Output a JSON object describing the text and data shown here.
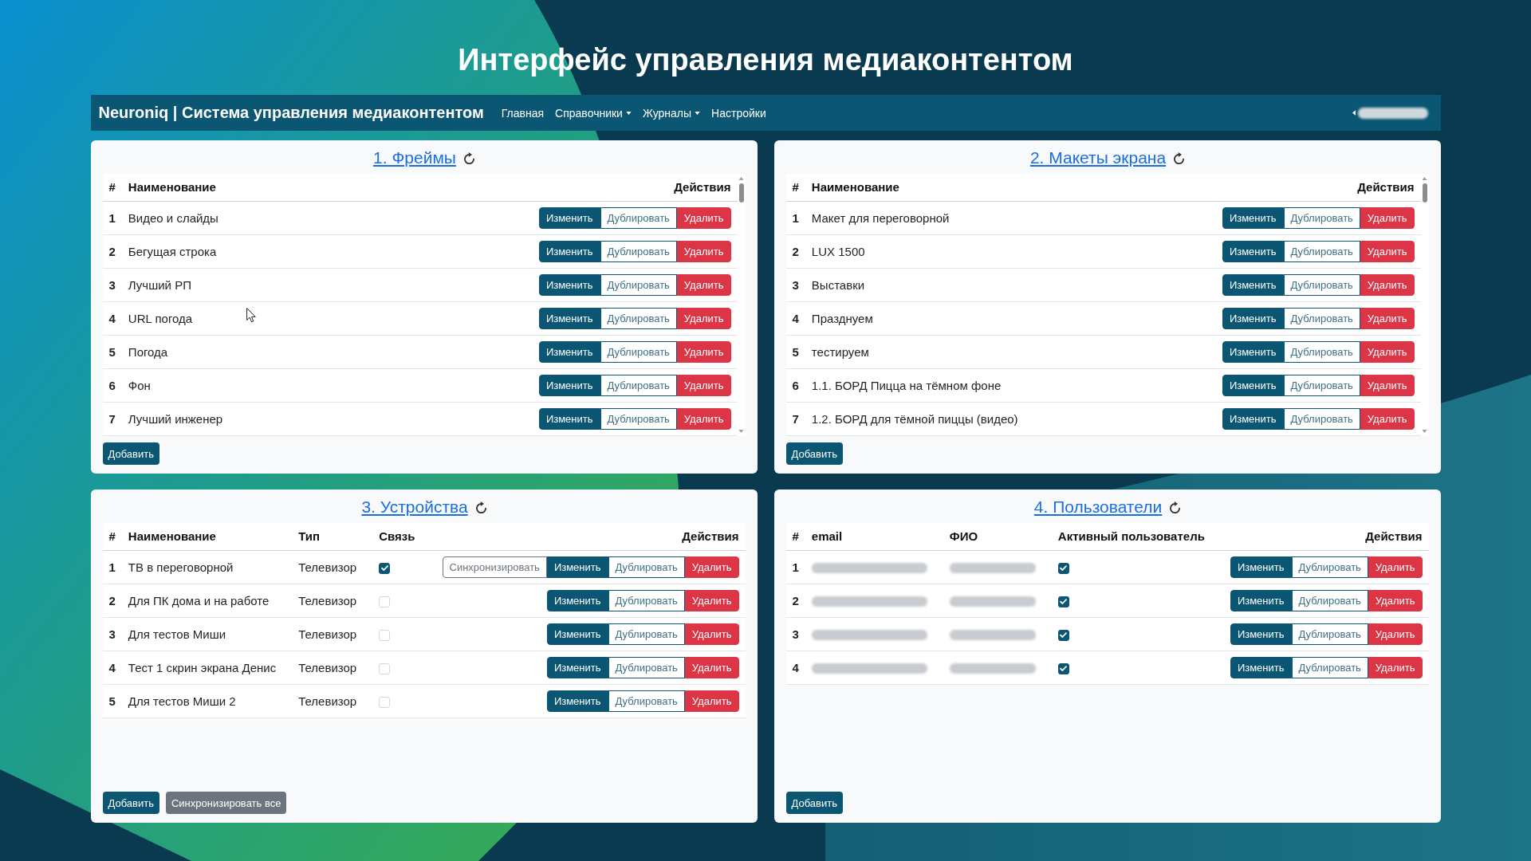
{
  "page_title": "Интерфейс управления медиаконтентом",
  "navbar": {
    "brand": "Neuroniq | Система управления медиаконтентом",
    "items": [
      {
        "label": "Главная",
        "dropdown": false
      },
      {
        "label": "Справочники",
        "dropdown": true
      },
      {
        "label": "Журналы",
        "dropdown": true
      },
      {
        "label": "Настройки",
        "dropdown": false
      }
    ],
    "user": {
      "dropdown": true,
      "redacted": true
    }
  },
  "panels": [
    {
      "title": "1. Фреймы",
      "scrollable": true,
      "columns": [
        {
          "label": "#",
          "kind": "index"
        },
        {
          "label": "Наименование",
          "kind": "text"
        },
        {
          "label": "Действия",
          "kind": "actions"
        }
      ],
      "rows": [
        {
          "cells": [
            "1",
            "Видео и слайды"
          ],
          "actions": [
            {
              "kind": "edit",
              "label": "Изменить"
            },
            {
              "kind": "duplicate",
              "label": "Дублировать"
            },
            {
              "kind": "delete",
              "label": "Удалить"
            }
          ]
        },
        {
          "cells": [
            "2",
            "Бегущая строка"
          ],
          "actions": [
            {
              "kind": "edit",
              "label": "Изменить"
            },
            {
              "kind": "duplicate",
              "label": "Дублировать"
            },
            {
              "kind": "delete",
              "label": "Удалить"
            }
          ]
        },
        {
          "cells": [
            "3",
            "Лучший РП"
          ],
          "actions": [
            {
              "kind": "edit",
              "label": "Изменить"
            },
            {
              "kind": "duplicate",
              "label": "Дублировать"
            },
            {
              "kind": "delete",
              "label": "Удалить"
            }
          ]
        },
        {
          "cells": [
            "4",
            "URL погода"
          ],
          "actions": [
            {
              "kind": "edit",
              "label": "Изменить"
            },
            {
              "kind": "duplicate",
              "label": "Дублировать"
            },
            {
              "kind": "delete",
              "label": "Удалить"
            }
          ]
        },
        {
          "cells": [
            "5",
            "Погода"
          ],
          "actions": [
            {
              "kind": "edit",
              "label": "Изменить"
            },
            {
              "kind": "duplicate",
              "label": "Дублировать"
            },
            {
              "kind": "delete",
              "label": "Удалить"
            }
          ]
        },
        {
          "cells": [
            "6",
            "Фон"
          ],
          "actions": [
            {
              "kind": "edit",
              "label": "Изменить"
            },
            {
              "kind": "duplicate",
              "label": "Дублировать"
            },
            {
              "kind": "delete",
              "label": "Удалить"
            }
          ]
        },
        {
          "cells": [
            "7",
            "Лучший инженер"
          ],
          "actions": [
            {
              "kind": "edit",
              "label": "Изменить"
            },
            {
              "kind": "duplicate",
              "label": "Дублировать"
            },
            {
              "kind": "delete",
              "label": "Удалить"
            }
          ]
        }
      ],
      "buttons": [
        {
          "kind": "add",
          "label": "Добавить"
        }
      ]
    },
    {
      "title": "2. Макеты экрана",
      "scrollable": true,
      "columns": [
        {
          "label": "#",
          "kind": "index"
        },
        {
          "label": "Наименование",
          "kind": "text"
        },
        {
          "label": "Действия",
          "kind": "actions"
        }
      ],
      "rows": [
        {
          "cells": [
            "1",
            "Макет для переговорной"
          ],
          "actions": [
            {
              "kind": "edit",
              "label": "Изменить"
            },
            {
              "kind": "duplicate",
              "label": "Дублировать"
            },
            {
              "kind": "delete",
              "label": "Удалить"
            }
          ]
        },
        {
          "cells": [
            "2",
            "LUX 1500"
          ],
          "actions": [
            {
              "kind": "edit",
              "label": "Изменить"
            },
            {
              "kind": "duplicate",
              "label": "Дублировать"
            },
            {
              "kind": "delete",
              "label": "Удалить"
            }
          ]
        },
        {
          "cells": [
            "3",
            "Выставки"
          ],
          "actions": [
            {
              "kind": "edit",
              "label": "Изменить"
            },
            {
              "kind": "duplicate",
              "label": "Дублировать"
            },
            {
              "kind": "delete",
              "label": "Удалить"
            }
          ]
        },
        {
          "cells": [
            "4",
            "Празднуем"
          ],
          "actions": [
            {
              "kind": "edit",
              "label": "Изменить"
            },
            {
              "kind": "duplicate",
              "label": "Дублировать"
            },
            {
              "kind": "delete",
              "label": "Удалить"
            }
          ]
        },
        {
          "cells": [
            "5",
            "тестируем"
          ],
          "actions": [
            {
              "kind": "edit",
              "label": "Изменить"
            },
            {
              "kind": "duplicate",
              "label": "Дублировать"
            },
            {
              "kind": "delete",
              "label": "Удалить"
            }
          ]
        },
        {
          "cells": [
            "6",
            "1.1. БОРД Пицца на тёмном фоне"
          ],
          "actions": [
            {
              "kind": "edit",
              "label": "Изменить"
            },
            {
              "kind": "duplicate",
              "label": "Дублировать"
            },
            {
              "kind": "delete",
              "label": "Удалить"
            }
          ]
        },
        {
          "cells": [
            "7",
            "1.2. БОРД для тёмной пиццы (видео)"
          ],
          "actions": [
            {
              "kind": "edit",
              "label": "Изменить"
            },
            {
              "kind": "duplicate",
              "label": "Дублировать"
            },
            {
              "kind": "delete",
              "label": "Удалить"
            }
          ]
        }
      ],
      "buttons": [
        {
          "kind": "add",
          "label": "Добавить"
        }
      ]
    },
    {
      "title": "3. Устройства",
      "scrollable": false,
      "columns": [
        {
          "label": "#",
          "kind": "index"
        },
        {
          "label": "Наименование",
          "kind": "text"
        },
        {
          "label": "Тип",
          "kind": "text"
        },
        {
          "label": "Связь",
          "kind": "check"
        },
        {
          "label": "Действия",
          "kind": "actions"
        }
      ],
      "rows": [
        {
          "cells": [
            "1",
            "ТВ в переговорной",
            "Телевизор",
            {
              "checked": true
            }
          ],
          "actions": [
            {
              "kind": "sync",
              "label": "Синхронизировать"
            },
            {
              "kind": "edit",
              "label": "Изменить"
            },
            {
              "kind": "duplicate",
              "label": "Дублировать"
            },
            {
              "kind": "delete",
              "label": "Удалить"
            }
          ]
        },
        {
          "cells": [
            "2",
            "Для ПК дома и на работе",
            "Телевизор",
            {
              "checked": false
            }
          ],
          "actions": [
            {
              "kind": "edit",
              "label": "Изменить"
            },
            {
              "kind": "duplicate",
              "label": "Дублировать"
            },
            {
              "kind": "delete",
              "label": "Удалить"
            }
          ]
        },
        {
          "cells": [
            "3",
            "Для тестов Миши",
            "Телевизор",
            {
              "checked": false
            }
          ],
          "actions": [
            {
              "kind": "edit",
              "label": "Изменить"
            },
            {
              "kind": "duplicate",
              "label": "Дублировать"
            },
            {
              "kind": "delete",
              "label": "Удалить"
            }
          ]
        },
        {
          "cells": [
            "4",
            "Тест 1 скрин экрана Денис",
            "Телевизор",
            {
              "checked": false
            }
          ],
          "actions": [
            {
              "kind": "edit",
              "label": "Изменить"
            },
            {
              "kind": "duplicate",
              "label": "Дублировать"
            },
            {
              "kind": "delete",
              "label": "Удалить"
            }
          ]
        },
        {
          "cells": [
            "5",
            "Для тестов Миши 2",
            "Телевизор",
            {
              "checked": false
            }
          ],
          "actions": [
            {
              "kind": "edit",
              "label": "Изменить"
            },
            {
              "kind": "duplicate",
              "label": "Дублировать"
            },
            {
              "kind": "delete",
              "label": "Удалить"
            }
          ]
        }
      ],
      "buttons": [
        {
          "kind": "add",
          "label": "Добавить"
        },
        {
          "kind": "sync_all",
          "label": "Синхронизировать все"
        }
      ]
    },
    {
      "title": "4. Пользователи",
      "scrollable": false,
      "columns": [
        {
          "label": "#",
          "kind": "index"
        },
        {
          "label": "email",
          "kind": "text"
        },
        {
          "label": "ФИО",
          "kind": "text"
        },
        {
          "label": "Активный пользователь",
          "kind": "check"
        },
        {
          "label": "Действия",
          "kind": "actions"
        }
      ],
      "rows": [
        {
          "cells": [
            "1",
            {
              "redacted": true
            },
            {
              "redacted": true
            },
            {
              "checked": true
            }
          ],
          "actions": [
            {
              "kind": "edit",
              "label": "Изменить"
            },
            {
              "kind": "duplicate",
              "label": "Дублировать"
            },
            {
              "kind": "delete",
              "label": "Удалить"
            }
          ]
        },
        {
          "cells": [
            "2",
            {
              "redacted": true
            },
            {
              "redacted": true
            },
            {
              "checked": true
            }
          ],
          "actions": [
            {
              "kind": "edit",
              "label": "Изменить"
            },
            {
              "kind": "duplicate",
              "label": "Дублировать"
            },
            {
              "kind": "delete",
              "label": "Удалить"
            }
          ]
        },
        {
          "cells": [
            "3",
            {
              "redacted": true
            },
            {
              "redacted": true
            },
            {
              "checked": true
            }
          ],
          "actions": [
            {
              "kind": "edit",
              "label": "Изменить"
            },
            {
              "kind": "duplicate",
              "label": "Дублировать"
            },
            {
              "kind": "delete",
              "label": "Удалить"
            }
          ]
        },
        {
          "cells": [
            "4",
            {
              "redacted": true
            },
            {
              "redacted": true
            },
            {
              "checked": true
            }
          ],
          "actions": [
            {
              "kind": "edit",
              "label": "Изменить"
            },
            {
              "kind": "duplicate",
              "label": "Дублировать"
            },
            {
              "kind": "delete",
              "label": "Удалить"
            }
          ]
        }
      ],
      "buttons": [
        {
          "kind": "add",
          "label": "Добавить"
        }
      ]
    }
  ]
}
